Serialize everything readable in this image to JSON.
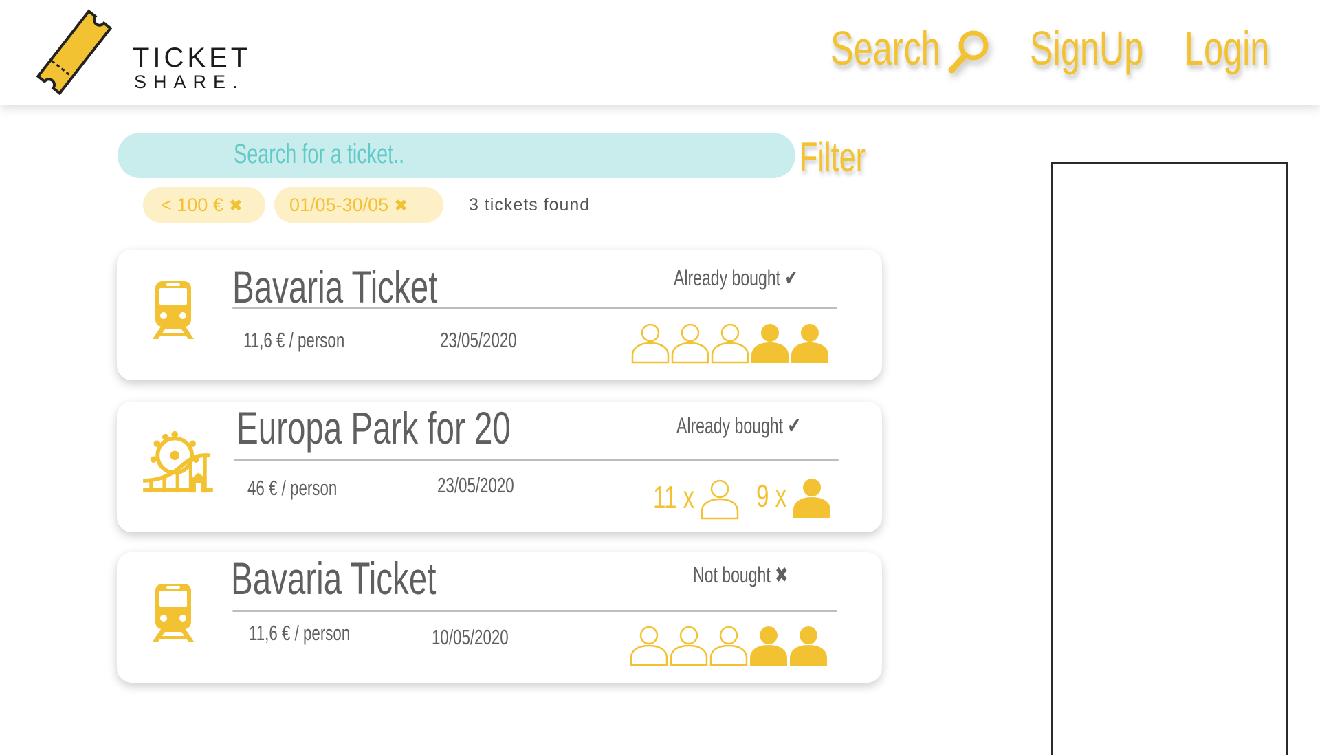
{
  "brand": {
    "line1": "TICKET",
    "line2": "SHARE."
  },
  "nav": {
    "search": "Search",
    "signup": "SignUp",
    "login": "Login"
  },
  "search": {
    "placeholder": "Search for a ticket.."
  },
  "filter": {
    "label": "Filter"
  },
  "chips": [
    {
      "label": "< 100 €"
    },
    {
      "label": "01/05-30/05"
    }
  ],
  "chip_remove_glyph": "✖",
  "results": {
    "text": "3 tickets found"
  },
  "colors": {
    "accent": "#f2c233",
    "chip_bg": "#fdefc6",
    "search_bg": "#c9ecec",
    "search_text": "#62c9c9",
    "text": "#5f5f5f"
  },
  "tickets": [
    {
      "icon": "train-icon",
      "title": "Bavaria Ticket",
      "status": "Already bought ✔",
      "price": "11,6 € / person",
      "date": "23/05/2020",
      "slots": [
        "free",
        "free",
        "free",
        "taken",
        "taken"
      ]
    },
    {
      "icon": "amusement-park-icon",
      "title": "Europa Park for 20",
      "status": "Already bought ✔",
      "price": "46 € / person",
      "date": "23/05/2020",
      "free_count": "11 x",
      "taken_count": "9 x"
    },
    {
      "icon": "train-icon",
      "title": "Bavaria Ticket",
      "status": "Not bought ✖",
      "price": "11,6 € / person",
      "date": "10/05/2020",
      "slots": [
        "free",
        "free",
        "free",
        "taken",
        "taken"
      ]
    }
  ]
}
